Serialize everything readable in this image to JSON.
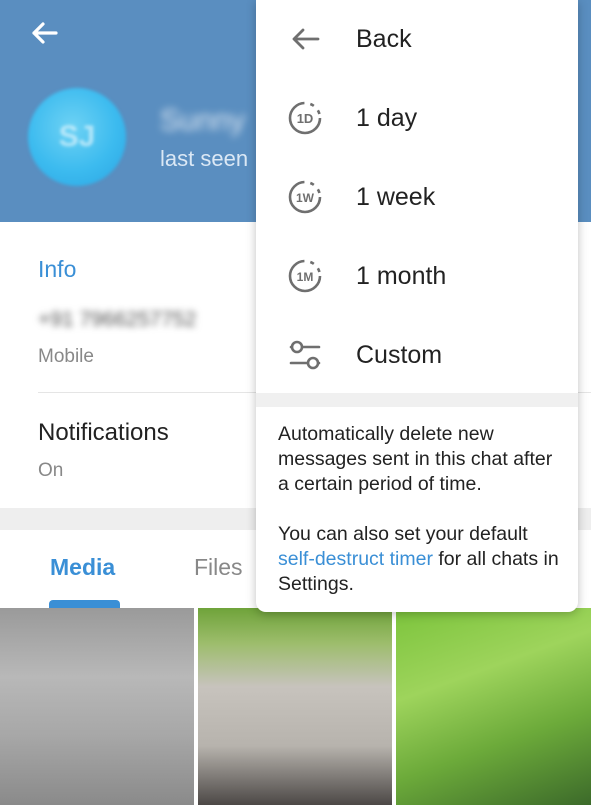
{
  "header": {
    "back_icon": "arrow-left-icon",
    "avatar_initials": "SJ",
    "name": "Sunny",
    "status": "last seen"
  },
  "info": {
    "title": "Info",
    "phone": "+91 7966257752",
    "phone_label": "Mobile",
    "notifications_title": "Notifications",
    "notifications_status": "On"
  },
  "tabs": {
    "items": [
      {
        "label": "Media",
        "active": true
      },
      {
        "label": "Files",
        "active": false
      }
    ]
  },
  "popup": {
    "menu": [
      {
        "label": "Back",
        "icon": "arrow-left-icon"
      },
      {
        "label": "1 day",
        "icon": "timer-1d-icon"
      },
      {
        "label": "1 week",
        "icon": "timer-1w-icon"
      },
      {
        "label": "1 month",
        "icon": "timer-1m-icon"
      },
      {
        "label": "Custom",
        "icon": "sliders-icon"
      }
    ],
    "note_line1": "Automatically delete new messages sent in this chat after a certain period of time.",
    "note_line2_prefix": "You can also set your default ",
    "note_link": "self-destruct timer",
    "note_line2_suffix": " for all chats in Settings."
  },
  "colors": {
    "header_bg": "#5a8ec0",
    "accent": "#3a8fd6"
  }
}
